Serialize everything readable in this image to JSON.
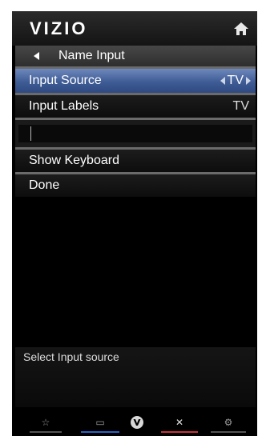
{
  "header": {
    "brand": "VIZIO",
    "home_icon": "home-icon"
  },
  "title_row": {
    "back_icon": "left-arrow-icon",
    "label": "Name Input"
  },
  "menu": {
    "items": [
      {
        "label": "Input Source",
        "value": "TV",
        "selected": true
      },
      {
        "label": "Input Labels",
        "value": "TV",
        "selected": false
      }
    ],
    "actions": [
      {
        "label": "Show Keyboard"
      },
      {
        "label": "Done"
      }
    ]
  },
  "status": {
    "text": "Select Input source"
  },
  "bottom_bar": {
    "buttons": [
      {
        "icon": "star-icon",
        "glyph": "☆",
        "color": "#555555"
      },
      {
        "icon": "screen-icon",
        "glyph": "▭",
        "color": "#2b63c8"
      },
      {
        "icon": "vizio-v-icon",
        "glyph": "V",
        "color": "#000000"
      },
      {
        "icon": "close-icon",
        "glyph": "✕",
        "color": "#c8343a"
      },
      {
        "icon": "gear-icon",
        "glyph": "⚙",
        "color": "#555555"
      }
    ]
  },
  "colors": {
    "selected_row": "#3f5c96",
    "background": "#000000"
  }
}
